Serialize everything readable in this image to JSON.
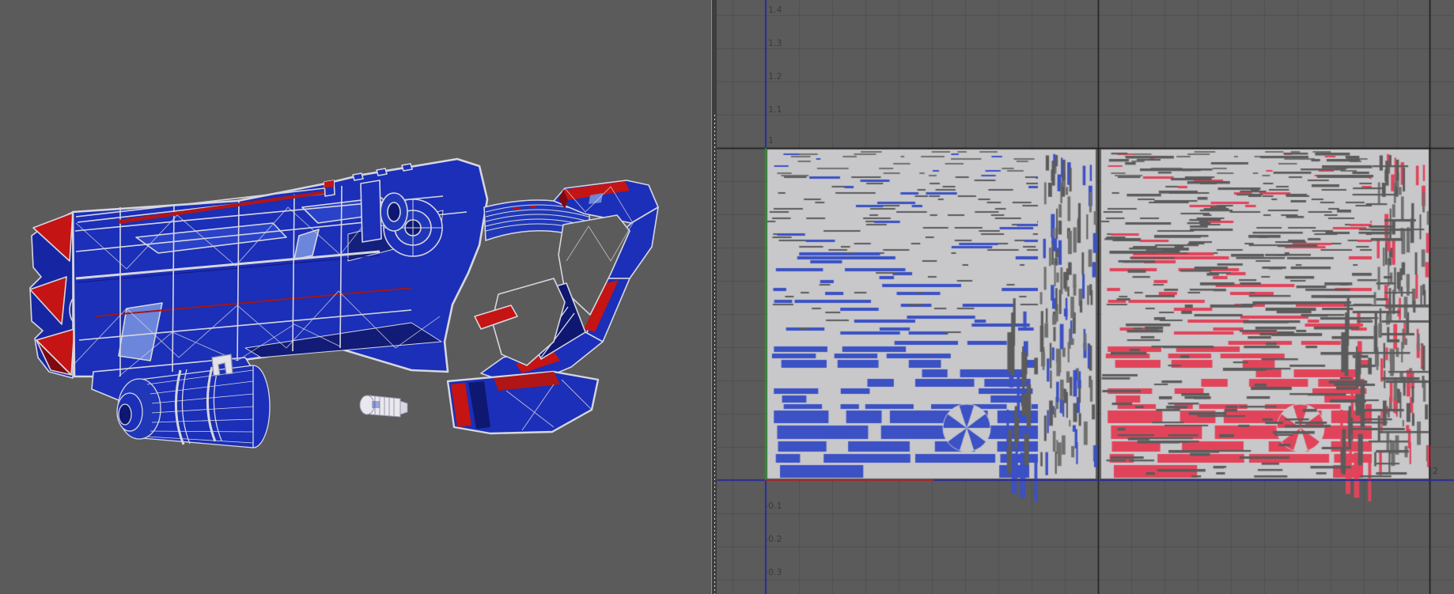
{
  "uv_editor": {
    "v_ticks": [
      "1.4",
      "1.3",
      "1.2",
      "1.1",
      "1",
      "-0.1",
      "-0.2",
      "-0.3"
    ],
    "u_ticks": [
      "2"
    ]
  },
  "colors": {
    "background": "#5B5B5B",
    "grid_line": "#505050",
    "grid_integer_line": "#1A1A1A",
    "axis_blue": "#2B2B96",
    "axis_green": "#18A018",
    "axis_red": "#A82525",
    "uv_wire_light": "#C8C8CB",
    "uv_fleck_gray": "#70706F",
    "uv_shell_blue": "#3B51C4",
    "uv_shell_red": "#E1445A",
    "model_blue": "#1B2FB8",
    "model_red": "#C41414",
    "model_wire": "#D6D6DE"
  }
}
